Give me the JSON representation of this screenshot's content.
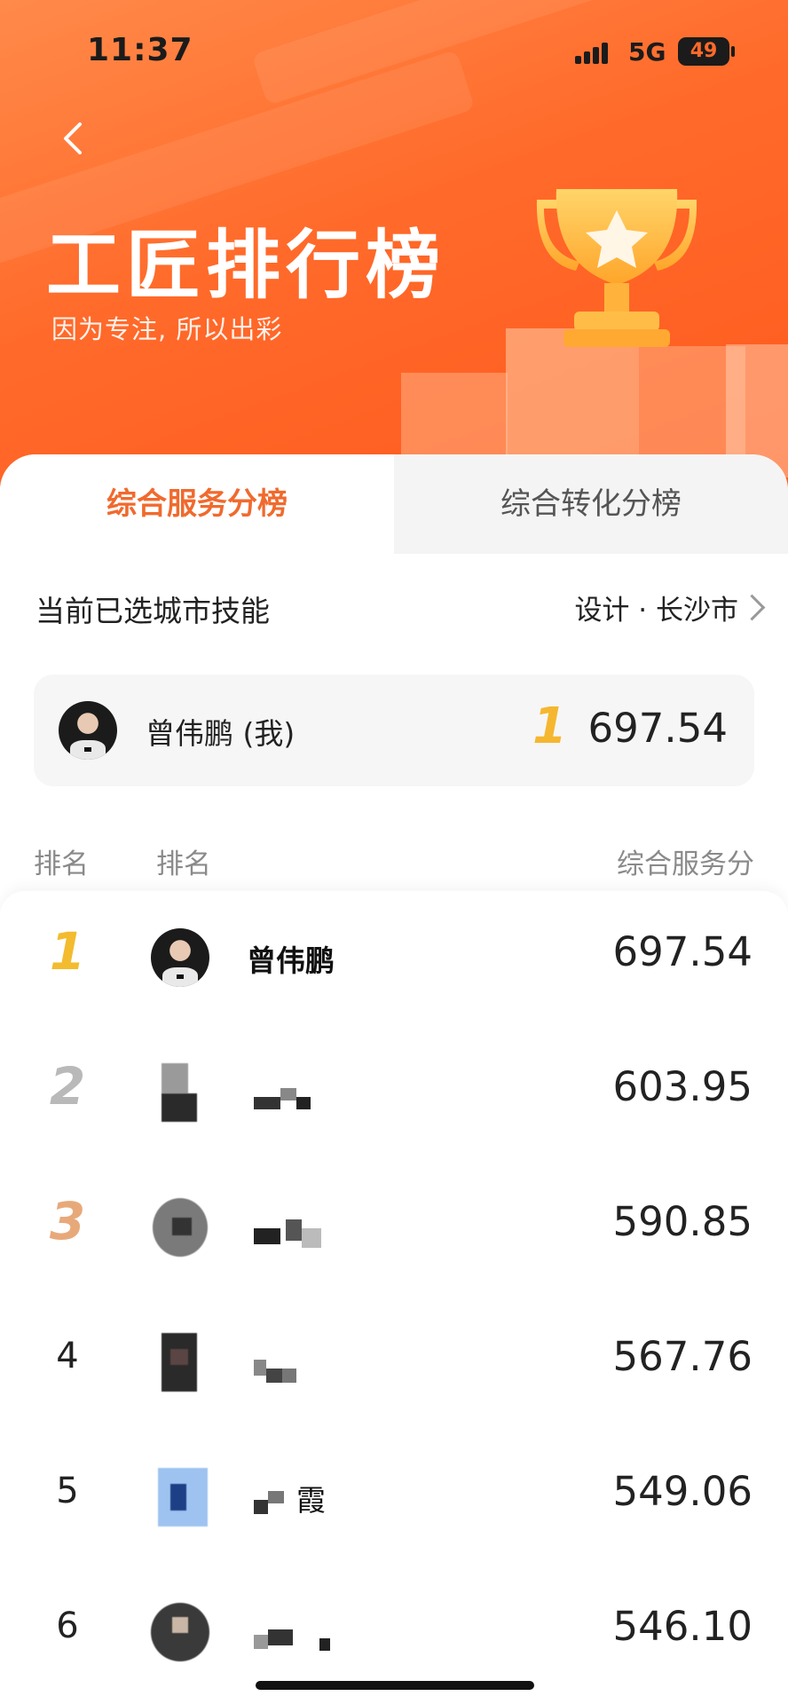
{
  "status_bar": {
    "time": "11:37",
    "network": "5G",
    "battery": "49"
  },
  "header": {
    "title": "工匠排行榜",
    "subtitle": "因为专注, 所以出彩"
  },
  "tabs": [
    {
      "label": "综合服务分榜",
      "active": true
    },
    {
      "label": "综合转化分榜",
      "active": false
    }
  ],
  "filter": {
    "label": "当前已选城市技能",
    "value": "设计 · 长沙市"
  },
  "my_rank": {
    "name": "曾伟鹏 (我)",
    "rank": "1",
    "score": "697.54"
  },
  "table_header": {
    "rank": "排名",
    "name": "排名",
    "score": "综合服务分"
  },
  "rows": [
    {
      "rank": "1",
      "name": "曾伟鹏",
      "score": "697.54"
    },
    {
      "rank": "2",
      "name": "",
      "score": "603.95"
    },
    {
      "rank": "3",
      "name": "",
      "score": "590.85"
    },
    {
      "rank": "4",
      "name": "",
      "score": "567.76"
    },
    {
      "rank": "5",
      "name": "霞",
      "score": "549.06"
    },
    {
      "rank": "6",
      "name": "",
      "score": "546.10"
    }
  ],
  "colors": {
    "accent": "#f06a2e",
    "header_bg": "#ff6a2a",
    "gold": "#f3bb2e",
    "silver": "#b9b9b9",
    "bronze": "#e8a97a"
  }
}
